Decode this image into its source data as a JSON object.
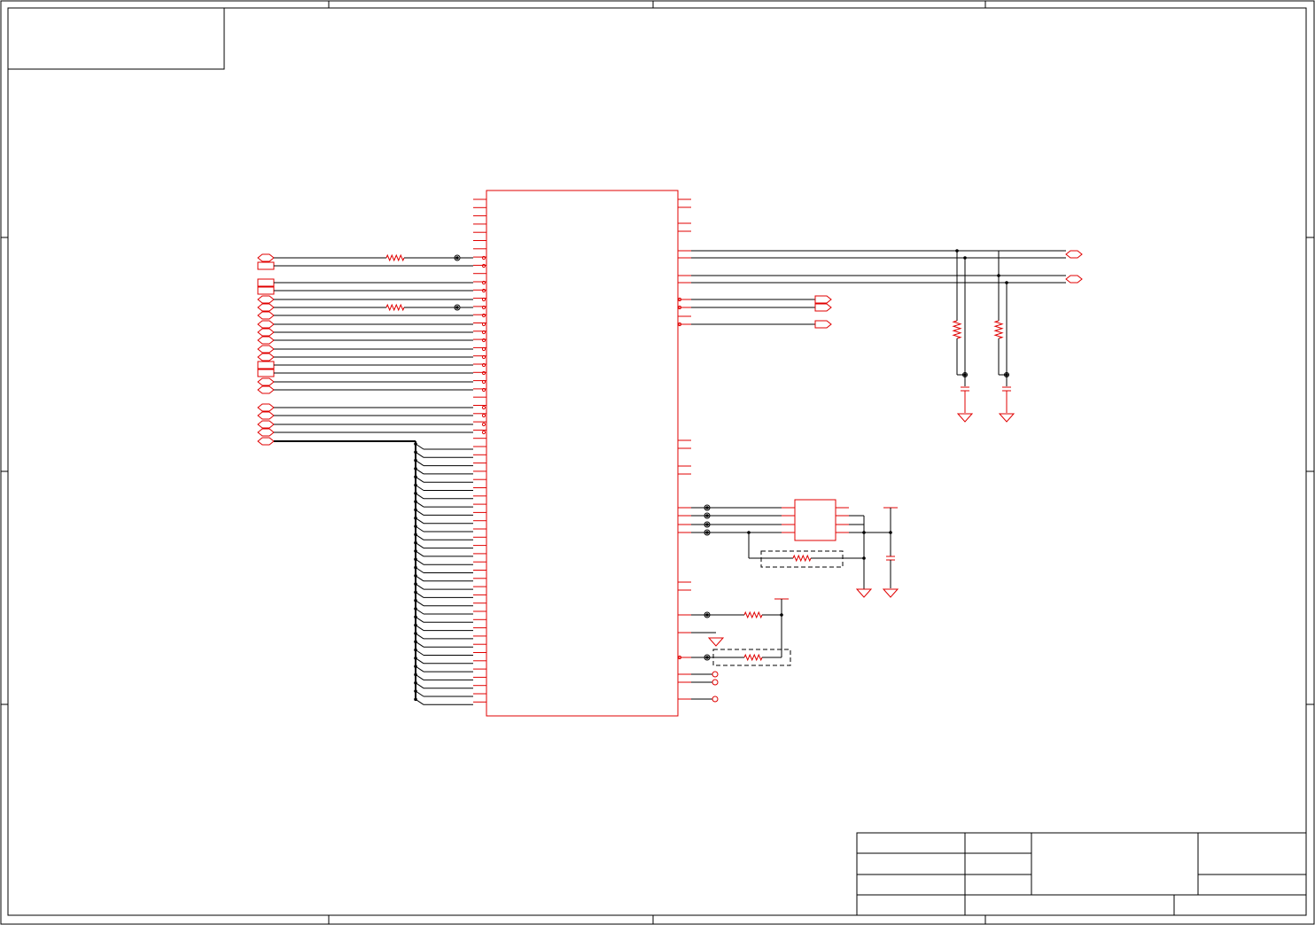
{
  "document": {
    "title": "",
    "colors": {
      "frame": "#000000",
      "component": "#e00000",
      "wire": "#000000",
      "port": "#e00000",
      "background": "#ffffff"
    }
  },
  "title_block": {
    "rows": [
      "",
      "",
      "",
      ""
    ],
    "values": [
      "",
      "",
      ""
    ],
    "center": "",
    "right_top": "",
    "right_bottom": ""
  },
  "symbols": {
    "resistor": "resistor-symbol",
    "capacitor": "capacitor-symbol",
    "ground": "ground-symbol",
    "power": "power-bar-symbol",
    "port": "off-page-port-symbol",
    "test_point": "test-point-symbol",
    "junction": "junction-dot"
  }
}
